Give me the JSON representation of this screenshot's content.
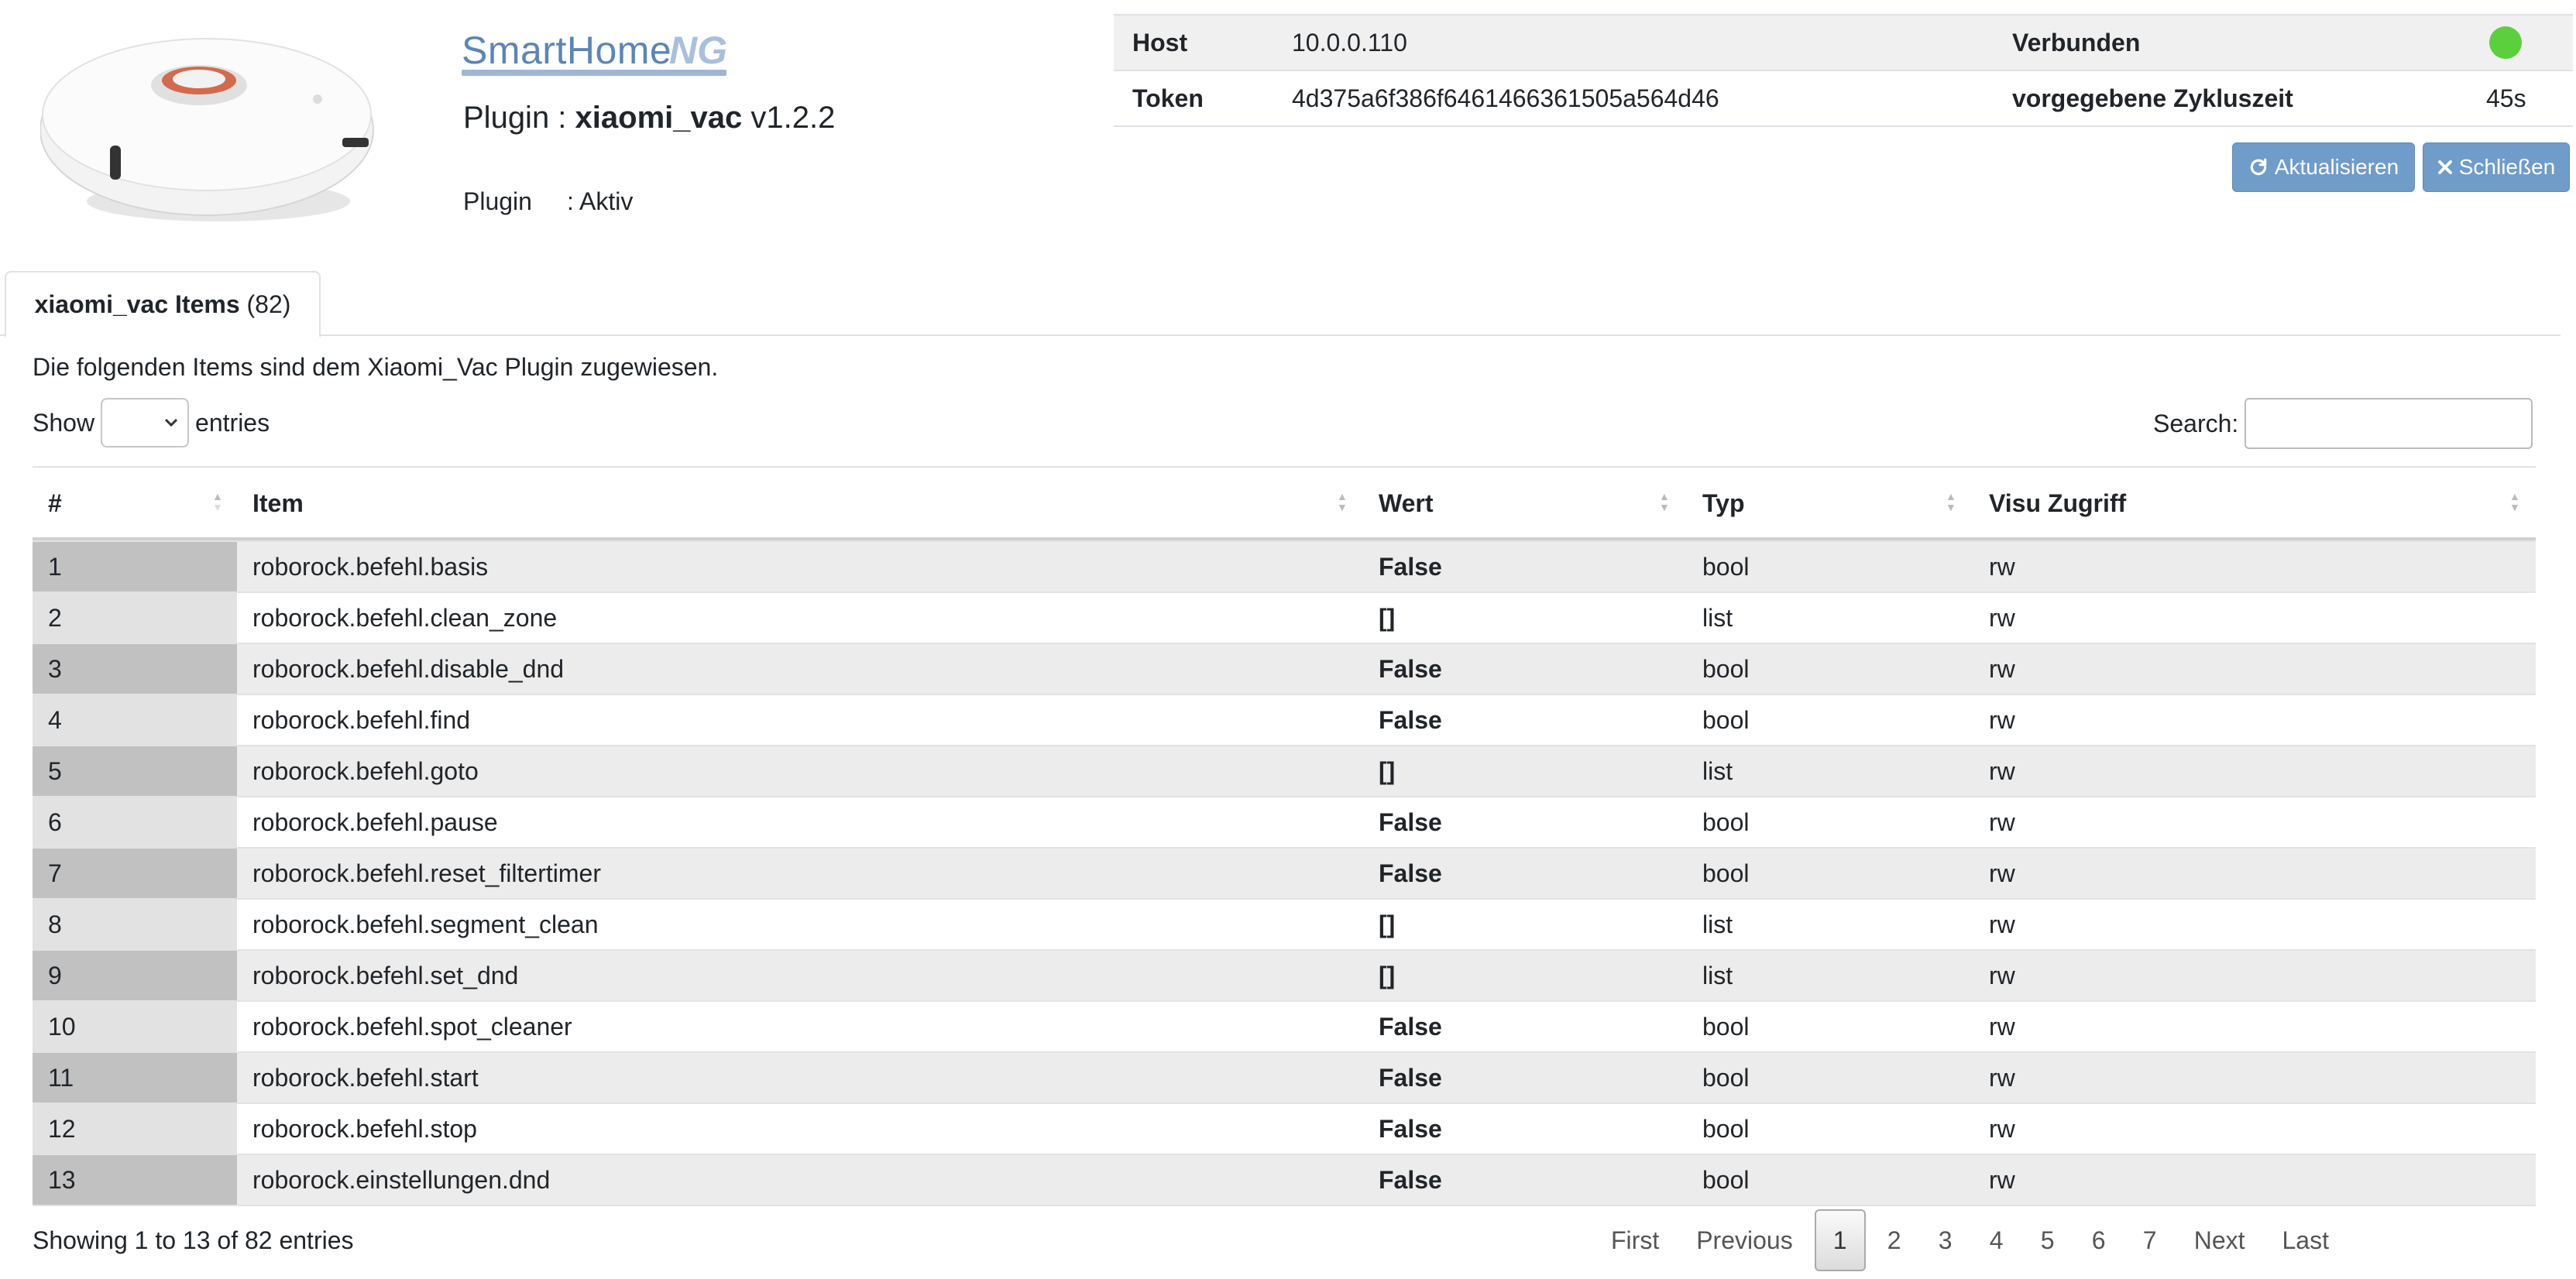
{
  "header": {
    "logo_smart": "SmartHome",
    "logo_ng": "NG",
    "plugin_prefix": "Plugin :",
    "plugin_name": "xiaomi_vac",
    "plugin_version": "v1.2.2",
    "status_label": "Plugin",
    "status_value": ": Aktiv"
  },
  "info": {
    "host_label": "Host",
    "host_value": "10.0.0.110",
    "connected_label": "Verbunden",
    "connected_color": "#5ccf3d",
    "token_label": "Token",
    "token_value": "4d375a6f386f6461466361505a564d46",
    "cycle_label": "vorgegebene Zykluszeit",
    "cycle_value": "45s"
  },
  "buttons": {
    "refresh_icon": "refresh-icon",
    "refresh_label": "Aktualisieren",
    "close_icon": "close-icon",
    "close_label": "Schließen"
  },
  "tab": {
    "label": "xiaomi_vac Items",
    "count": "(82)"
  },
  "description": "Die folgenden Items sind dem Xiaomi_Vac Plugin zugewiesen.",
  "length": {
    "show_label": "Show",
    "entries_label": "entries"
  },
  "search": {
    "label": "Search:",
    "value": ""
  },
  "table": {
    "columns": [
      "#",
      "Item",
      "Wert",
      "Typ",
      "Visu Zugriff"
    ],
    "rows": [
      {
        "num": "1",
        "item": "roborock.befehl.basis",
        "wert": "False",
        "typ": "bool",
        "visu": "rw"
      },
      {
        "num": "2",
        "item": "roborock.befehl.clean_zone",
        "wert": "[]",
        "typ": "list",
        "visu": "rw"
      },
      {
        "num": "3",
        "item": "roborock.befehl.disable_dnd",
        "wert": "False",
        "typ": "bool",
        "visu": "rw"
      },
      {
        "num": "4",
        "item": "roborock.befehl.find",
        "wert": "False",
        "typ": "bool",
        "visu": "rw"
      },
      {
        "num": "5",
        "item": "roborock.befehl.goto",
        "wert": "[]",
        "typ": "list",
        "visu": "rw"
      },
      {
        "num": "6",
        "item": "roborock.befehl.pause",
        "wert": "False",
        "typ": "bool",
        "visu": "rw"
      },
      {
        "num": "7",
        "item": "roborock.befehl.reset_filtertimer",
        "wert": "False",
        "typ": "bool",
        "visu": "rw"
      },
      {
        "num": "8",
        "item": "roborock.befehl.segment_clean",
        "wert": "[]",
        "typ": "list",
        "visu": "rw"
      },
      {
        "num": "9",
        "item": "roborock.befehl.set_dnd",
        "wert": "[]",
        "typ": "list",
        "visu": "rw"
      },
      {
        "num": "10",
        "item": "roborock.befehl.spot_cleaner",
        "wert": "False",
        "typ": "bool",
        "visu": "rw"
      },
      {
        "num": "11",
        "item": "roborock.befehl.start",
        "wert": "False",
        "typ": "bool",
        "visu": "rw"
      },
      {
        "num": "12",
        "item": "roborock.befehl.stop",
        "wert": "False",
        "typ": "bool",
        "visu": "rw"
      },
      {
        "num": "13",
        "item": "roborock.einstellungen.dnd",
        "wert": "False",
        "typ": "bool",
        "visu": "rw"
      }
    ]
  },
  "footer": {
    "showing": "Showing 1 to 13 of 82 entries"
  },
  "pagination": {
    "first": "First",
    "previous": "Previous",
    "pages": [
      "1",
      "2",
      "3",
      "4",
      "5",
      "6",
      "7"
    ],
    "active": "1",
    "next": "Next",
    "last": "Last"
  }
}
